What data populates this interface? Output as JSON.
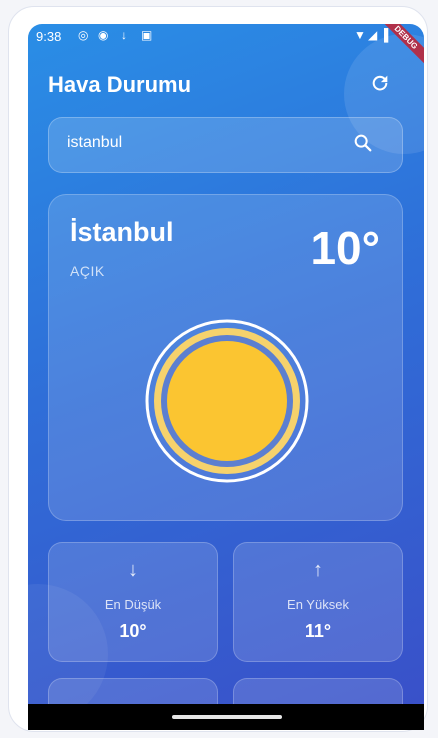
{
  "status_bar": {
    "time": "9:38",
    "icons": [
      "shield-outline-icon",
      "shield-filled-icon",
      "download-icon",
      "app-icon",
      "wifi-icon",
      "signal-icon",
      "battery-icon"
    ],
    "debug_banner": "DEBUG"
  },
  "header": {
    "title": "Hava Durumu",
    "refresh_icon": "refresh-icon"
  },
  "search": {
    "value": "istanbul",
    "icon": "search-icon"
  },
  "weather": {
    "city": "İstanbul",
    "condition": "AÇIK",
    "temperature": "10°",
    "icon": "sun-icon",
    "sun_color": "#fbc531"
  },
  "stats": [
    {
      "icon": "arrow-down-icon",
      "label": "En Düşük",
      "value": "10°"
    },
    {
      "icon": "arrow-up-icon",
      "label": "En Yüksek",
      "value": "11°"
    }
  ],
  "colors": {
    "background_top": "#2a8ee6",
    "background_bottom": "#3a4fc8",
    "sun": "#fbc531",
    "sun_ring": "#f6d26c"
  }
}
